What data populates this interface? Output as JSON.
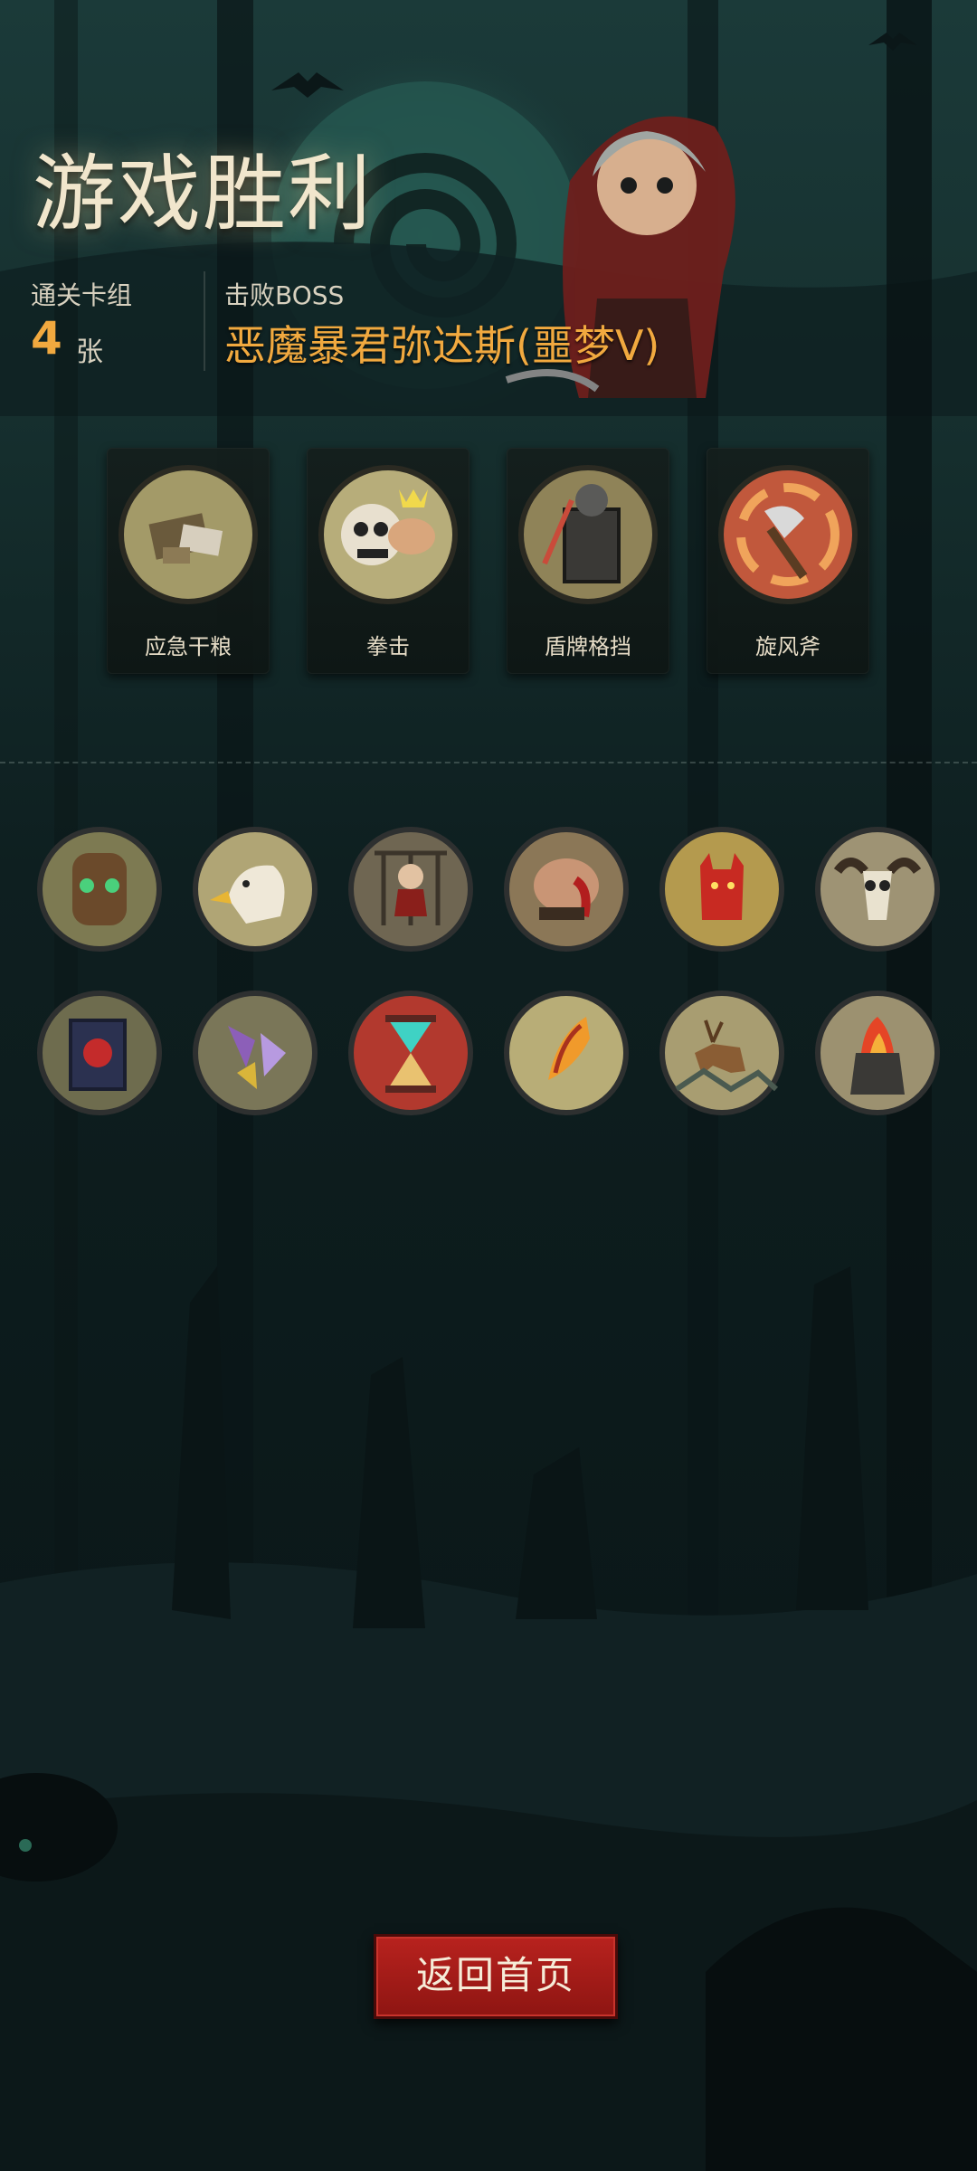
{
  "screen": {
    "title": "游戏胜利"
  },
  "stats": {
    "deck_label": "通关卡组",
    "deck_count": "4",
    "deck_unit": "张",
    "boss_label": "击败BOSS",
    "boss_name": "恶魔暴君弥达斯(噩梦V)"
  },
  "cards": [
    {
      "name": "应急干粮",
      "icon": "ration-icon"
    },
    {
      "name": "拳击",
      "icon": "punch-icon"
    },
    {
      "name": "盾牌格挡",
      "icon": "shield-block-icon"
    },
    {
      "name": "旋风斧",
      "icon": "whirlwind-axe-icon"
    }
  ],
  "relics": [
    {
      "icon": "wooden-mask-icon"
    },
    {
      "icon": "eagle-icon"
    },
    {
      "icon": "caged-girl-icon"
    },
    {
      "icon": "bloody-fist-icon"
    },
    {
      "icon": "red-demon-icon"
    },
    {
      "icon": "horned-skull-icon"
    },
    {
      "icon": "red-book-icon"
    },
    {
      "icon": "purple-shards-icon"
    },
    {
      "icon": "hourglass-icon"
    },
    {
      "icon": "fire-feather-icon"
    },
    {
      "icon": "deer-icon"
    },
    {
      "icon": "flame-altar-icon"
    }
  ],
  "actions": {
    "home_label": "返回首页"
  },
  "colors": {
    "accent": "#f1a93f",
    "button": "#b8221e",
    "background": "#0b1719"
  }
}
